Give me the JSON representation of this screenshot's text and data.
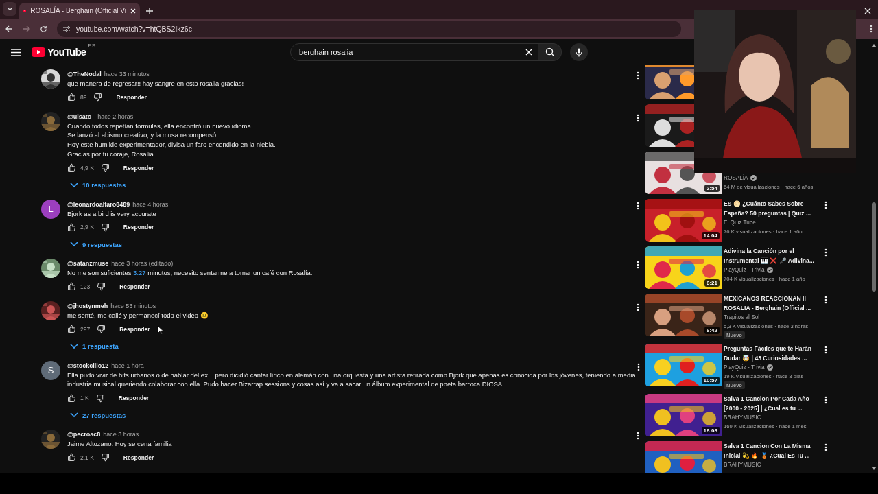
{
  "browser": {
    "tab": {
      "title": "ROSALÍA - Berghain (Official Vi",
      "selected": true
    },
    "url": "youtube.com/watch?v=htQBS2Ikz6c"
  },
  "header": {
    "logo": "YouTube",
    "region": "ES",
    "search": {
      "value": "berghain rosalia"
    }
  },
  "comments": [
    {
      "avatar": {
        "kind": "picture"
      },
      "author": "@TheNodal",
      "time": "hace 33 minutos",
      "lines": [
        "que manera de regresar!! hay sangre en esto rosalia gracias!"
      ],
      "likes": "89",
      "reply_label": "Responder"
    },
    {
      "avatar": {
        "kind": "picture"
      },
      "author": "@uisato_",
      "time": "hace 2 horas",
      "lines": [
        "Cuando todos repetían fórmulas, ella encontró un nuevo idioma.",
        "Se lanzó al abismo creativo, y la musa recompensó.",
        "Hoy este humilde experimentador, divisa un faro encendido en la niebla.",
        "Gracias por tu coraje, Rosalía."
      ],
      "likes": "4,9 K",
      "reply_label": "Responder",
      "replies": "10 respuestas"
    },
    {
      "avatar": {
        "kind": "letter",
        "letter": "L",
        "color": "#9c3fbf"
      },
      "author": "@leonardoalfaro8489",
      "time": "hace 4 horas",
      "lines": [
        "Bjork as a bird is very accurate"
      ],
      "likes": "2,9 K",
      "reply_label": "Responder",
      "replies": "9 respuestas"
    },
    {
      "avatar": {
        "kind": "picture"
      },
      "author": "@satanzmuse",
      "time": "hace 3 horas (editado)",
      "timestamp_line": {
        "before": "No me son suficientes",
        "link": "3:27",
        "after": "minutos, necesito sentarme a tomar un café con Rosalía."
      },
      "likes": "123",
      "reply_label": "Responder"
    },
    {
      "avatar": {
        "kind": "picture"
      },
      "author": "@jhostynmeh",
      "time": "hace 53 minutos",
      "lines": [
        "me senté, me callé y permanecí todo el video 😐"
      ],
      "likes": "297",
      "reply_label": "Responder",
      "replies": "1 respuesta"
    },
    {
      "avatar": {
        "kind": "letter",
        "letter": "S",
        "color": "#5f6b78"
      },
      "author": "@stockcillo12",
      "time": "hace 1 hora",
      "lines": [
        "Ella pudo vivir de hits urbanos o de hablar del ex... pero dicidió cantar lírico en alemán con una orquesta y una artista retirada como Bjork que apenas es conocida por los jóvenes, teniendo a media",
        "industria musical queriendo colaborar con ella. Pudo hacer Bizarrap sessions y cosas así y va a sacar un álbum experimental de poeta barroca DIOSA"
      ],
      "likes": "1 K",
      "reply_label": "Responder",
      "replies": "27 respuestas"
    },
    {
      "avatar": {
        "kind": "picture"
      },
      "author": "@pecroac8",
      "time": "hace 3 horas",
      "lines": [
        "Jaime Altozano: Hoy se cena familia"
      ],
      "likes": "2,1 K",
      "reply_label": "Responder"
    }
  ],
  "sidebar": {
    "items": [
      {
        "kind": "thumbnail_only",
        "menu": false
      },
      {
        "kind": "thumbnail_only",
        "menu": false
      },
      {
        "kind": "video",
        "menu": false,
        "duration": "2:54",
        "channel": "ROSALÍA",
        "verified": true,
        "meta": "64 M de visualizaciones · hace 6 años"
      },
      {
        "kind": "video",
        "menu": true,
        "duration": "14:04",
        "title_lines": [
          "ES 🌕 ¿Cuánto Sabes Sobre",
          "España?  50 preguntas | Quiz ..."
        ],
        "channel": "El Quiz Tube",
        "verified": false,
        "meta": "76 K visualizaciones · hace 1 año"
      },
      {
        "kind": "video",
        "menu": true,
        "duration": "8:21",
        "title_lines": [
          "Adivina la Canción por el",
          "Instrumental 🎹 ❌ 🎤 Adivina..."
        ],
        "channel": "PlayQuiz - Trivia",
        "verified": true,
        "meta": "704 K visualizaciones · hace 1 año"
      },
      {
        "kind": "video",
        "menu": true,
        "duration": "6:42",
        "title_lines": [
          "MEXICANOS REACCIONAN II",
          "ROSALÍA - Berghain (Official ..."
        ],
        "channel": "Trapitos al Sol",
        "verified": false,
        "meta": "5,3 K visualizaciones · hace 3 horas",
        "badge": "Nuevo"
      },
      {
        "kind": "video",
        "menu": true,
        "duration": "10:57",
        "title_lines": [
          "Preguntas Fáciles que te Harán",
          "Dudar 🤯 | 43 Curiosidades ..."
        ],
        "channel": "PlayQuiz - Trivia",
        "verified": true,
        "meta": "19 K visualizaciones · hace 3 días",
        "badge": "Nuevo"
      },
      {
        "kind": "video",
        "menu": true,
        "duration": "18:08",
        "title_lines": [
          "Salva 1 Cancion Por Cada Año",
          "[2000 - 2025] | ¿Cual es tu ..."
        ],
        "channel": "BRAHYMUSIC",
        "verified": false,
        "meta": "169 K visualizaciones · hace 1 mes"
      },
      {
        "kind": "video",
        "menu": true,
        "title_lines": [
          "Salva 1 Cancion Con La Misma",
          "Inicial 💫 🔥 🥉 ¿Cual Es Tu ..."
        ],
        "channel": "BRAHYMUSIC",
        "verified": false
      }
    ]
  },
  "webcam": {
    "kind": "picture"
  }
}
